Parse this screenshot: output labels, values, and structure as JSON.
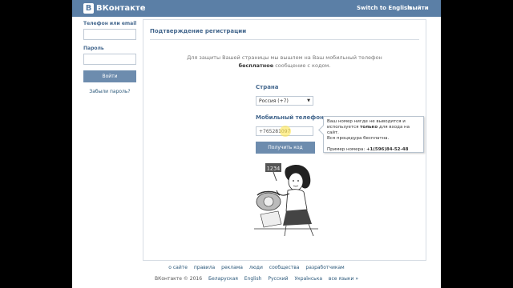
{
  "header": {
    "logo_text": "ВКонтакте",
    "logo_letter": "В",
    "switch_lang": "Switch to English",
    "logout": "выйти"
  },
  "sidebar": {
    "phone_label": "Телефон или email",
    "password_label": "Пароль",
    "login_button": "Войти",
    "forgot_link": "Забыли пароль?"
  },
  "main": {
    "title": "Подтверждение регистрации",
    "info_line1": "Для защиты Вашей страницы мы вышлем на Ваш мобильный телефон",
    "info_bold": "бесплатное",
    "info_line2_rest": " сообщение с кодом.",
    "country_label": "Страна",
    "country_value": "Россия (+7)",
    "phone_label": "Мобильный телефон",
    "phone_value": "+765281097",
    "send_button": "Получить код"
  },
  "tooltip": {
    "line1": "Ваш номер нигде не выводится и",
    "line2_pre": "используется ",
    "line2_bold": "только",
    "line2_post": " для входа на сайт.",
    "line3": "Вся процедура бесплатна.",
    "example_label": "Пример номера: ",
    "example_value": "+1(596)84-52-48"
  },
  "illustration": {
    "sign_text": "1234"
  },
  "footer": {
    "links": [
      "о сайте",
      "правила",
      "реклама",
      "люди",
      "сообщества",
      "разработчикам"
    ],
    "copyright": "ВКонтакте © 2016",
    "languages": [
      "Беларуская",
      "English",
      "Русский",
      "Українська",
      "все языки »"
    ]
  },
  "colors": {
    "header_bg": "#5b7fa6",
    "button_bg": "#6d8cae",
    "link": "#2b587a"
  }
}
